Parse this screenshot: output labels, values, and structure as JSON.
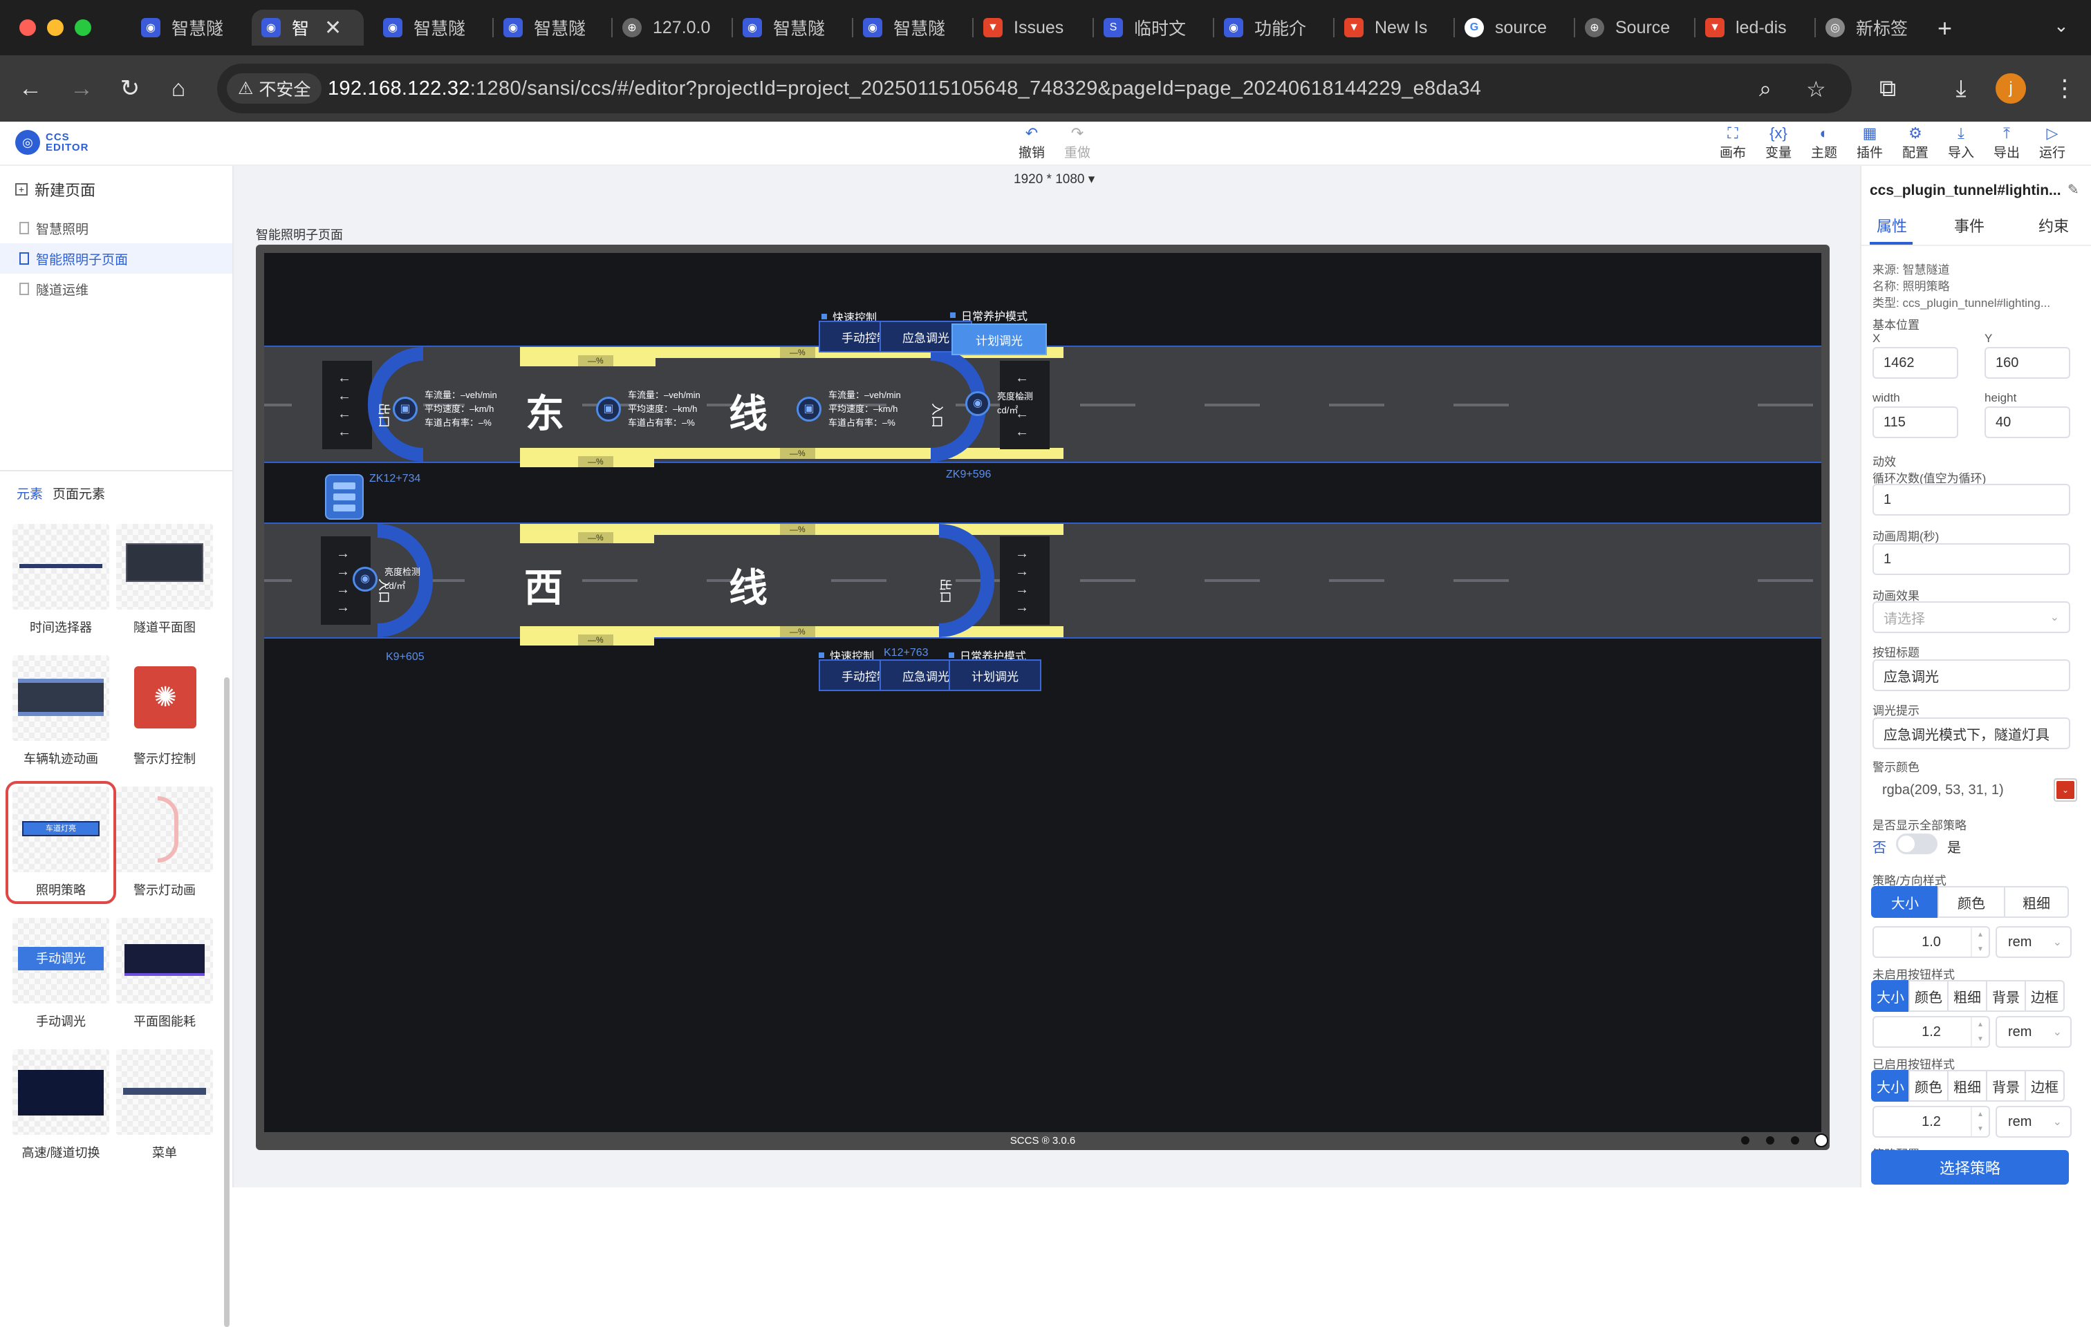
{
  "browser": {
    "tabs": [
      {
        "title": "智慧隧",
        "icon": "app-icon"
      },
      {
        "title": "智",
        "icon": "app-icon",
        "active": true
      },
      {
        "title": "智慧隧",
        "icon": "app-icon"
      },
      {
        "title": "智慧隧",
        "icon": "app-icon"
      },
      {
        "title": "127.0.0",
        "icon": "globe-icon"
      },
      {
        "title": "智慧隧",
        "icon": "app-icon"
      },
      {
        "title": "智慧隧",
        "icon": "app-icon"
      },
      {
        "title": "Issues",
        "icon": "gitlab-icon"
      },
      {
        "title": "临时文",
        "icon": "s-icon"
      },
      {
        "title": "功能介",
        "icon": "app-icon"
      },
      {
        "title": "New Is",
        "icon": "gitlab-icon"
      },
      {
        "title": "source",
        "icon": "google-icon"
      },
      {
        "title": "Source",
        "icon": "globe-icon"
      },
      {
        "title": "led-dis",
        "icon": "gitlab-icon"
      },
      {
        "title": "新标签",
        "icon": "chrome-icon"
      }
    ],
    "security_label": "不安全",
    "url_host": "192.168.122.32",
    "url_rest": ":1280/sansi/ccs/#/editor?projectId=project_20250115105648_748329&pageId=page_20240618144229_e8da34",
    "avatar_letter": "j"
  },
  "header": {
    "logo_line1": "CCS",
    "logo_line2": "EDITOR",
    "undo": "撤销",
    "redo": "重做",
    "tools": [
      "画布",
      "变量",
      "主题",
      "插件",
      "配置",
      "导入",
      "导出",
      "运行"
    ]
  },
  "left": {
    "new_page": "新建页面",
    "pages": [
      "智慧照明",
      "智能照明子页面",
      "隧道运维"
    ],
    "tab_elements": "元素",
    "tab_page_elements": "页面元素",
    "components": [
      "时间选择器",
      "隧道平面图",
      "车辆轨迹动画",
      "警示灯控制",
      "照明策略",
      "警示灯动画",
      "手动调光",
      "平面图能耗",
      "高速/隧道切换",
      "菜单"
    ],
    "thumb_manual_dimming": "手动调光",
    "thumb_lighting_strategy": "车道灯亮"
  },
  "canvas": {
    "resolution": "1920 * 1080",
    "page_title": "智能照明子页面",
    "footer": "SCCS ® 3.0.6",
    "east_chars": [
      "东",
      "线"
    ],
    "west_chars": [
      "西",
      "线"
    ],
    "pct_label": "—%",
    "stats": {
      "flow": "车流量：–veh/min",
      "speed": "平均速度：–km/h",
      "occupancy": "车道占有率：–%"
    },
    "brightness": "亮度检测",
    "brightness_unit": "cd/㎡",
    "exit_mark": "出口",
    "entry_mark": "入口",
    "mileage": {
      "zk12": "ZK12+734",
      "zk9": "ZK9+596",
      "k9": "K9+605",
      "k12": "K12+763"
    },
    "quick_control": "快速控制",
    "daily_mode": "日常养护模式",
    "manual_control": "手动控制",
    "emergency_dimming": "应急调光",
    "plan_dimming": "计划调光"
  },
  "right": {
    "title": "ccs_plugin_tunnel#lightin...",
    "tabs": [
      "属性",
      "事件",
      "约束"
    ],
    "source": "来源: 智慧隧道",
    "name": "名称: 照明策略",
    "type": "类型: ccs_plugin_tunnel#lighting...",
    "basic_position": "基本位置",
    "x_label": "X",
    "x_value": "1462",
    "y_label": "Y",
    "y_value": "160",
    "width_label": "width",
    "width_value": "115",
    "height_label": "height",
    "height_value": "40",
    "animation": "动效",
    "loop_label": "循环次数(值空为循环)",
    "loop_value": "1",
    "period_label": "动画周期(秒)",
    "period_value": "1",
    "effect_label": "动画效果",
    "effect_placeholder": "请选择",
    "button_title_label": "按钮标题",
    "button_title_value": "应急调光",
    "hint_label": "调光提示",
    "hint_value": "应急调光模式下，隧道灯具",
    "warn_color_label": "警示颜色",
    "warn_color_value": "rgba(209, 53, 31, 1)",
    "warn_color_hex": "#d1351f",
    "show_all_label": "是否显示全部策略",
    "no": "否",
    "yes": "是",
    "direction_style_label": "策略/方向样式",
    "seg3": [
      "大小",
      "颜色",
      "粗细"
    ],
    "direction_size": "1.0",
    "unit": "rem",
    "inactive_style_label": "未启用按钮样式",
    "seg5": [
      "大小",
      "颜色",
      "粗细",
      "背景",
      "边框"
    ],
    "inactive_size": "1.2",
    "active_style_label": "已启用按钮样式",
    "active_size": "1.2",
    "strategy_config_label": "策略配置",
    "select_strategy": "选择策略"
  }
}
